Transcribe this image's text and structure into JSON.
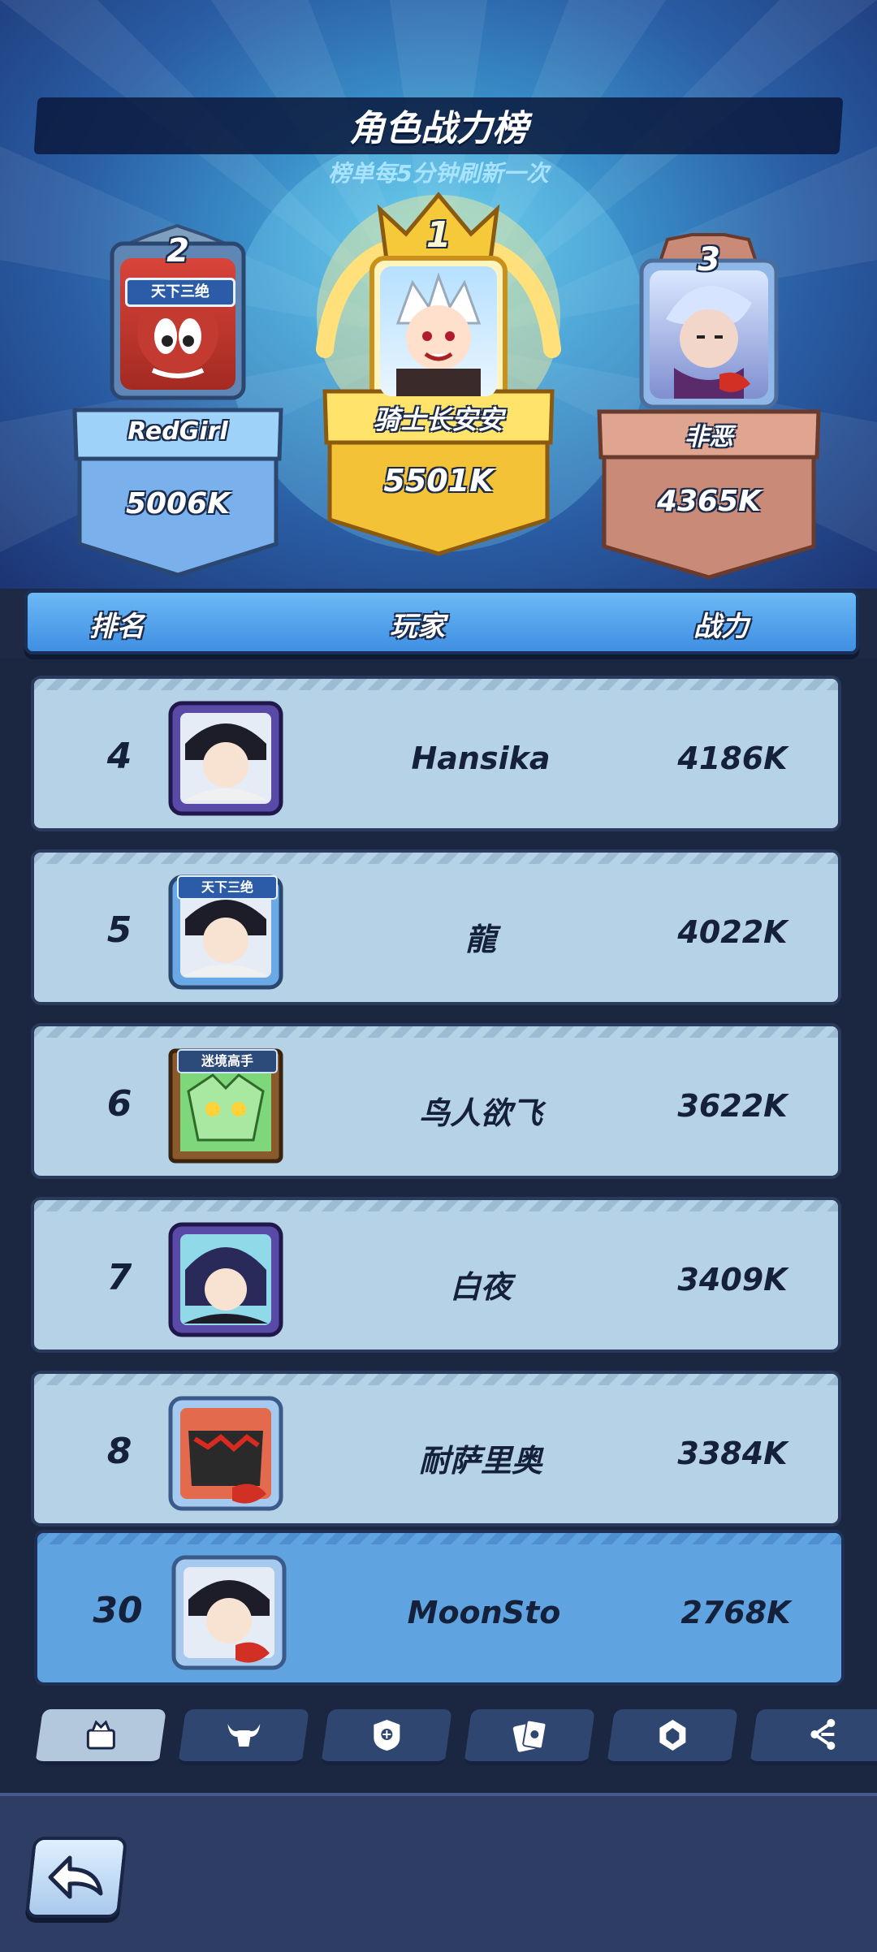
{
  "header": {
    "title": "角色战力榜",
    "subtitle": "榜单每5分钟刷新一次"
  },
  "podium": {
    "first": {
      "rank": "1",
      "name": "骑士长安安",
      "power": "5501K"
    },
    "second": {
      "rank": "2",
      "name": "RedGirl",
      "power": "5006K",
      "badge": "天下三绝"
    },
    "third": {
      "rank": "3",
      "name": "非恶",
      "power": "4365K"
    }
  },
  "table": {
    "columns": {
      "rank": "排名",
      "player": "玩家",
      "power": "战力"
    },
    "rows": [
      {
        "rank": "4",
        "name": "Hansika",
        "power": "4186K"
      },
      {
        "rank": "5",
        "name": "龍",
        "power": "4022K",
        "badge": "天下三绝"
      },
      {
        "rank": "6",
        "name": "鸟人欲飞",
        "power": "3622K",
        "badge": "迷境高手"
      },
      {
        "rank": "7",
        "name": "白夜",
        "power": "3409K"
      },
      {
        "rank": "8",
        "name": "耐萨里奥",
        "power": "3384K"
      }
    ],
    "self": {
      "rank": "30",
      "name": "MoonSto",
      "power": "2768K"
    }
  },
  "tabs": [
    {
      "icon": "character-tab-icon",
      "active": true
    },
    {
      "icon": "bull-tab-icon",
      "active": false
    },
    {
      "icon": "shield-tab-icon",
      "active": false
    },
    {
      "icon": "cards-tab-icon",
      "active": false
    },
    {
      "icon": "gem-tab-icon",
      "active": false
    },
    {
      "icon": "share-tab-icon",
      "active": false
    }
  ],
  "colors": {
    "gold": "#f6c93a",
    "silver_blue": "#7fb7ef",
    "bronze": "#c98a78",
    "row_bg": "#b6d2e6",
    "self_row_bg": "#5fa3e0"
  }
}
